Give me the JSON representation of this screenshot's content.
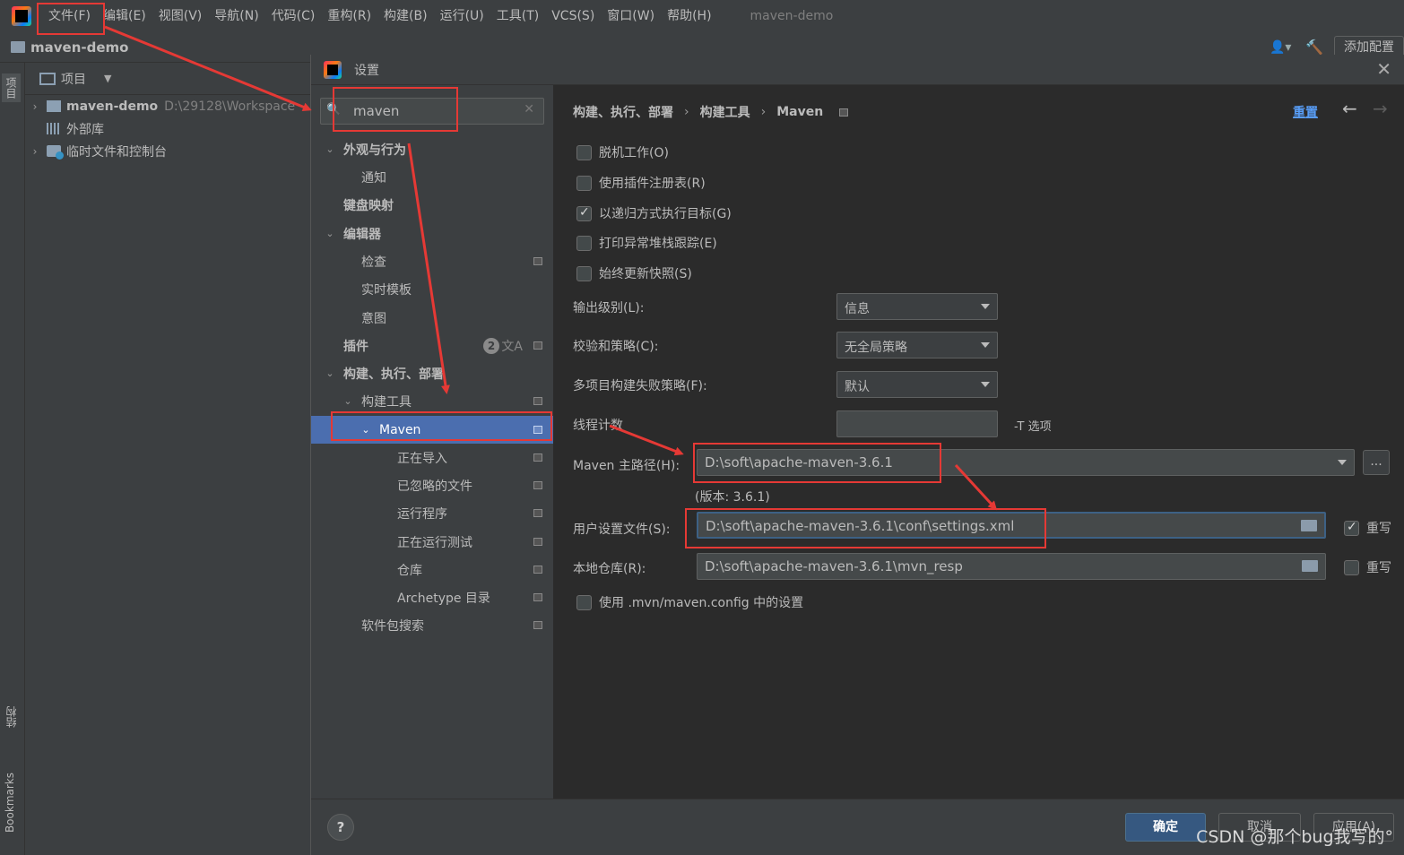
{
  "menubar": {
    "items": [
      "文件(F)",
      "编辑(E)",
      "视图(V)",
      "导航(N)",
      "代码(C)",
      "重构(R)",
      "构建(B)",
      "运行(U)",
      "工具(T)",
      "VCS(S)",
      "窗口(W)",
      "帮助(H)"
    ],
    "project_name": "maven-demo"
  },
  "navbar": {
    "title": "maven-demo",
    "add_config": "添加配置"
  },
  "left_strip": {
    "project_tab": "项目",
    "structure_tab": "结构",
    "bookmarks_tab": "Bookmarks"
  },
  "project_panel": {
    "header": "项目",
    "tree": [
      {
        "label": "maven-demo",
        "path": "D:\\29128\\Workspace"
      },
      {
        "label": "外部库"
      },
      {
        "label": "临时文件和控制台"
      }
    ]
  },
  "dialog": {
    "title": "设置",
    "search_value": "maven",
    "tree": [
      {
        "label": "外观与行为",
        "bold": true
      },
      {
        "label": "通知"
      },
      {
        "label": "键盘映射",
        "bold": true
      },
      {
        "label": "编辑器",
        "bold": true
      },
      {
        "label": "检查"
      },
      {
        "label": "实时模板"
      },
      {
        "label": "意图"
      },
      {
        "label": "插件",
        "bold": true,
        "badge": "2"
      },
      {
        "label": "构建、执行、部署",
        "bold": true
      },
      {
        "label": "构建工具"
      },
      {
        "label": "Maven"
      },
      {
        "label": "正在导入"
      },
      {
        "label": "已忽略的文件"
      },
      {
        "label": "运行程序"
      },
      {
        "label": "正在运行测试"
      },
      {
        "label": "仓库"
      },
      {
        "label": "Archetype 目录"
      },
      {
        "label": "软件包搜索"
      }
    ],
    "breadcrumb": [
      "构建、执行、部署",
      "构建工具",
      "Maven"
    ],
    "reset": "重置",
    "checkboxes": [
      {
        "label": "脱机工作(O)",
        "checked": false
      },
      {
        "label": "使用插件注册表(R)",
        "checked": false
      },
      {
        "label": "以递归方式执行目标(G)",
        "checked": true
      },
      {
        "label": "打印异常堆栈跟踪(E)",
        "checked": false
      },
      {
        "label": "始终更新快照(S)",
        "checked": false
      }
    ],
    "output_level": {
      "label": "输出级别(L):",
      "value": "信息"
    },
    "checksum": {
      "label": "校验和策略(C):",
      "value": "无全局策略"
    },
    "fail_policy": {
      "label": "多项目构建失败策略(F):",
      "value": "默认"
    },
    "threads": {
      "label": "线程计数",
      "value": "",
      "suffix": "-T 选项"
    },
    "maven_home": {
      "label": "Maven 主路径(H):",
      "value": "D:\\soft\\apache-maven-3.6.1",
      "version": "(版本: 3.6.1)",
      "browse": "..."
    },
    "user_settings": {
      "label": "用户设置文件(S):",
      "value": "D:\\soft\\apache-maven-3.6.1\\conf\\settings.xml",
      "override_label": "重写",
      "override": true
    },
    "local_repo": {
      "label": "本地仓库(R):",
      "value": "D:\\soft\\apache-maven-3.6.1\\mvn_resp",
      "override_label": "重写",
      "override": false
    },
    "mvn_config": {
      "label": "使用 .mvn/maven.config 中的设置",
      "checked": false
    },
    "buttons": {
      "help": "?",
      "ok": "确定",
      "cancel": "取消",
      "apply": "应用(A)"
    }
  },
  "watermark": "CSDN @那个bug我写的°",
  "colors": {
    "annotation": "#e53935",
    "selection": "#4b6eaf",
    "link": "#589df6",
    "primary_button": "#365880"
  }
}
